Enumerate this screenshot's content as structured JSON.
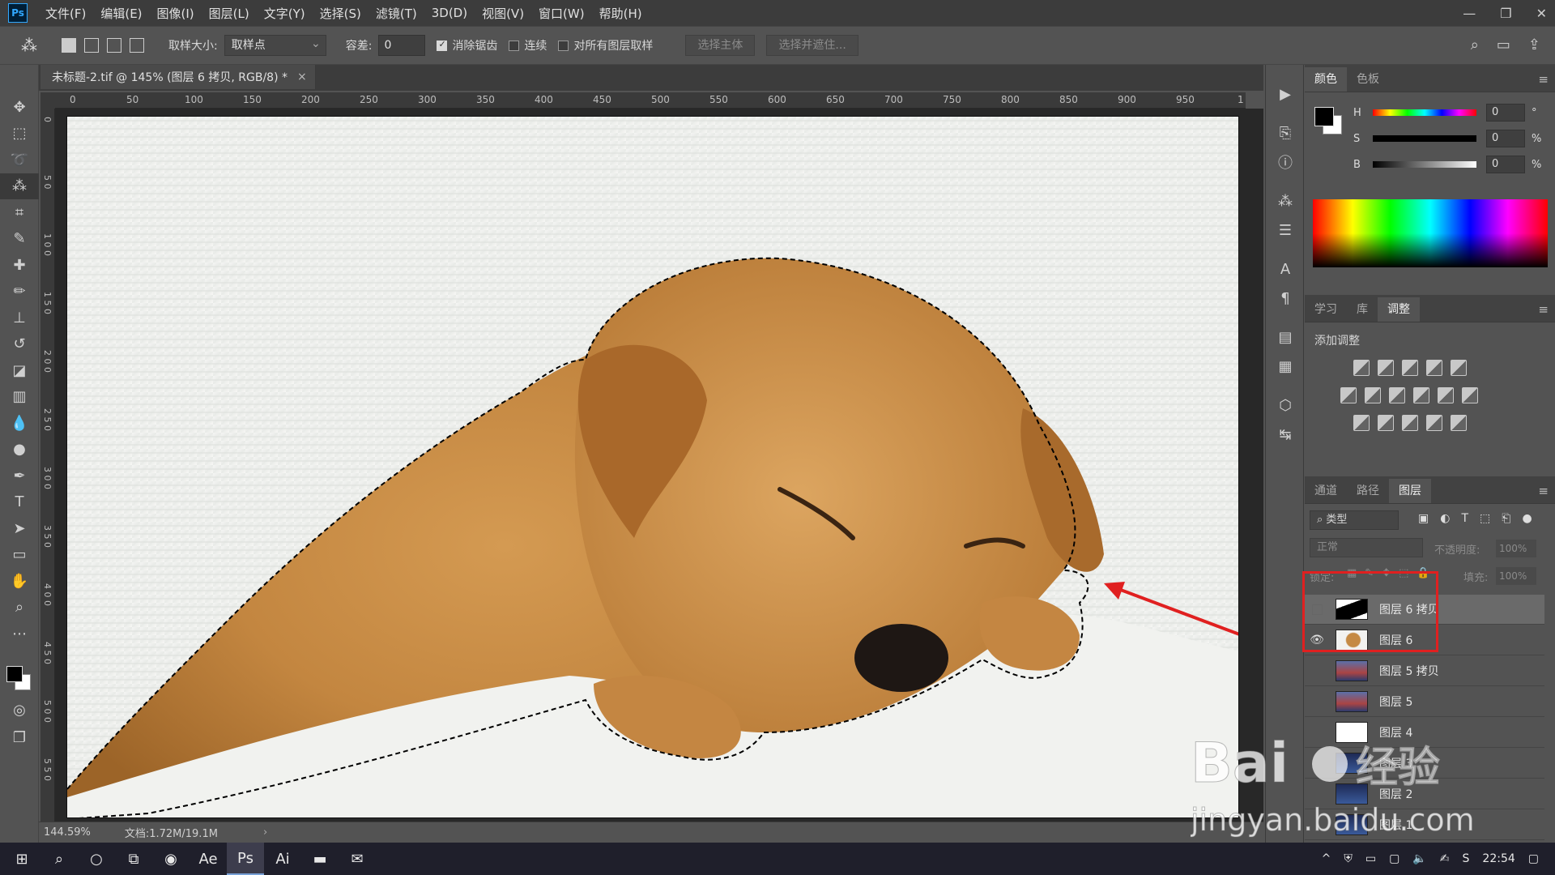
{
  "app": {
    "logo": "Ps"
  },
  "menu": [
    "文件(F)",
    "编辑(E)",
    "图像(I)",
    "图层(L)",
    "文字(Y)",
    "选择(S)",
    "滤镜(T)",
    "3D(D)",
    "视图(V)",
    "窗口(W)",
    "帮助(H)"
  ],
  "options": {
    "sample_size_label": "取样大小:",
    "sample_size_value": "取样点",
    "tolerance_label": "容差:",
    "tolerance_value": "0",
    "antialias_label": "消除锯齿",
    "contiguous_label": "连续",
    "sample_all_label": "对所有图层取样",
    "select_subject": "选择主体",
    "select_mask": "选择并遮住..."
  },
  "document": {
    "tab_title": "未标题-2.tif @ 145% (图层 6 拷贝, RGB/8) *",
    "zoom": "144.59%",
    "doc_size": "文档:1.72M/19.1M"
  },
  "ruler_h": [
    "0",
    "50",
    "100",
    "150",
    "200",
    "250",
    "300",
    "350",
    "400",
    "450",
    "500",
    "550",
    "600",
    "650",
    "700",
    "750",
    "800",
    "850",
    "900",
    "950",
    "1"
  ],
  "ruler_v": [
    "0",
    "5 0",
    "1 0 0",
    "1 5 0",
    "2 0 0",
    "2 5 0",
    "3 0 0",
    "3 5 0",
    "4 0 0",
    "4 5 0",
    "5 0 0",
    "5 5 0"
  ],
  "color_panel": {
    "tabs": [
      "颜色",
      "色板"
    ],
    "h_label": "H",
    "h_value": "0",
    "h_unit": "°",
    "s_label": "S",
    "s_value": "0",
    "s_unit": "%",
    "b_label": "B",
    "b_value": "0",
    "b_unit": "%",
    "fg_color": "#000000",
    "bg_color": "#ffffff"
  },
  "adjust_panel": {
    "tabs": [
      "学习",
      "库",
      "调整"
    ],
    "title": "添加调整"
  },
  "layers_panel": {
    "tabs": [
      "通道",
      "路径",
      "图层"
    ],
    "filter_label": "类型",
    "blend_mode": "正常",
    "opacity_label": "不透明度:",
    "opacity_value": "100%",
    "lock_label": "锁定:",
    "fill_label": "填充:",
    "fill_value": "100%",
    "layers": [
      {
        "name": "图层 6 拷贝",
        "visible": false,
        "selected": true
      },
      {
        "name": "图层 6",
        "visible": true,
        "selected": false
      },
      {
        "name": "图层 5 拷贝",
        "visible": false,
        "selected": false
      },
      {
        "name": "图层 5",
        "visible": false,
        "selected": false
      },
      {
        "name": "图层 4",
        "visible": false,
        "selected": false
      },
      {
        "name": "图层 3",
        "visible": false,
        "selected": false
      },
      {
        "name": "图层 2",
        "visible": false,
        "selected": false
      },
      {
        "name": "图层 1",
        "visible": false,
        "selected": false
      }
    ]
  },
  "taskbar": {
    "time": "22:54"
  },
  "watermark": {
    "brand": "Bai",
    "brand2": "经验",
    "url": "jingyan.baidu.com"
  }
}
